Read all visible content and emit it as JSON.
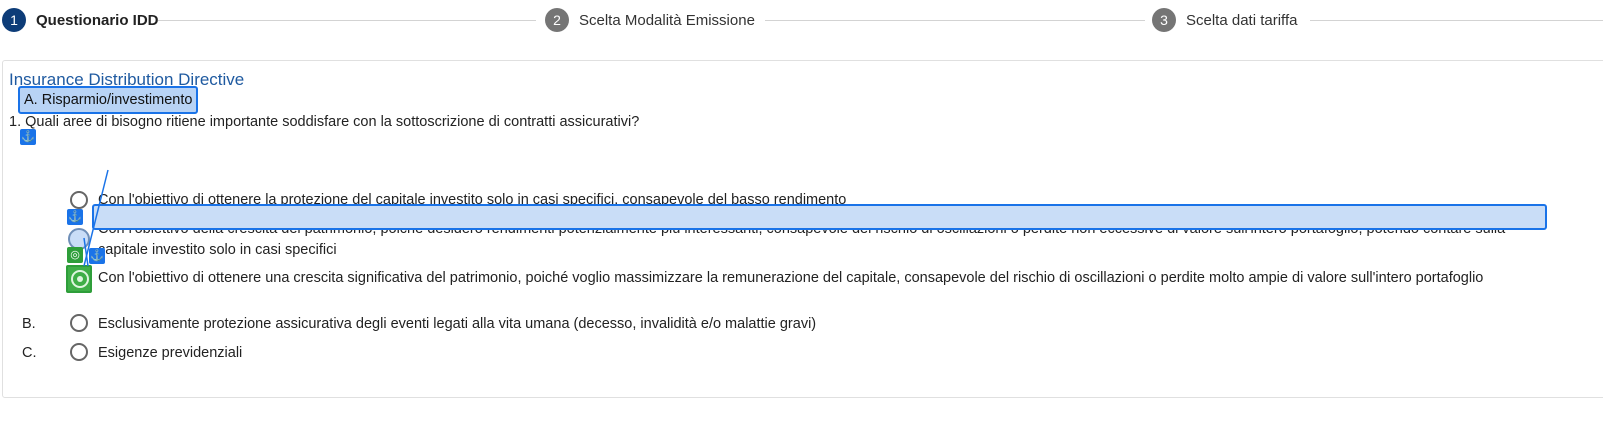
{
  "stepper": {
    "steps": [
      {
        "number": "1",
        "label": "Questionario IDD",
        "state": "active"
      },
      {
        "number": "2",
        "label": "Scelta Modalità Emissione",
        "state": "inactive"
      },
      {
        "number": "3",
        "label": "Scelta dati tariffa",
        "state": "inactive"
      }
    ]
  },
  "card": {
    "title": "Insurance Distribution Directive",
    "question": "1. Quali aree di bisogno ritiene importante soddisfare con la sottoscrizione di contratti assicurativi?",
    "category_a": {
      "label": "A. Risparmio/investimento",
      "options": [
        "Con l'obiettivo di ottenere la protezione del capitale investito solo in casi specifici, consapevole del basso rendimento",
        "Con l'obiettivo della crescita del patrimonio, poiché desidero rendimenti potenzialmente più interessanti, consapevole del rischio di oscillazioni o perdite non eccessive di valore sull'intero portafoglio, potendo contare sulla",
        "capitale investito solo in casi specifici",
        "Con l'obiettivo di ottenere una crescita significativa del patrimonio, poiché voglio massimizzare la remunerazione del capitale, consapevole del rischio di oscillazioni o perdite molto ampie di valore sull'intero portafoglio"
      ]
    },
    "category_b": {
      "letter": "B.",
      "label": "Esclusivamente protezione assicurativa degli eventi legati alla vita umana (decesso, invalidità e/o malattie gravi)"
    },
    "category_c": {
      "letter": "C.",
      "label": "Esigenze previdenziali"
    }
  },
  "icons": {
    "anchor": "anchor-icon",
    "target": "target-icon"
  },
  "colors": {
    "active_step": "#0d3c78",
    "inactive_step": "#757575",
    "title": "#1f5aa0",
    "anchor_badge": "#1a73e8",
    "target_badge": "#2e9e3a",
    "highlight_fill": "#c9ddf7"
  }
}
